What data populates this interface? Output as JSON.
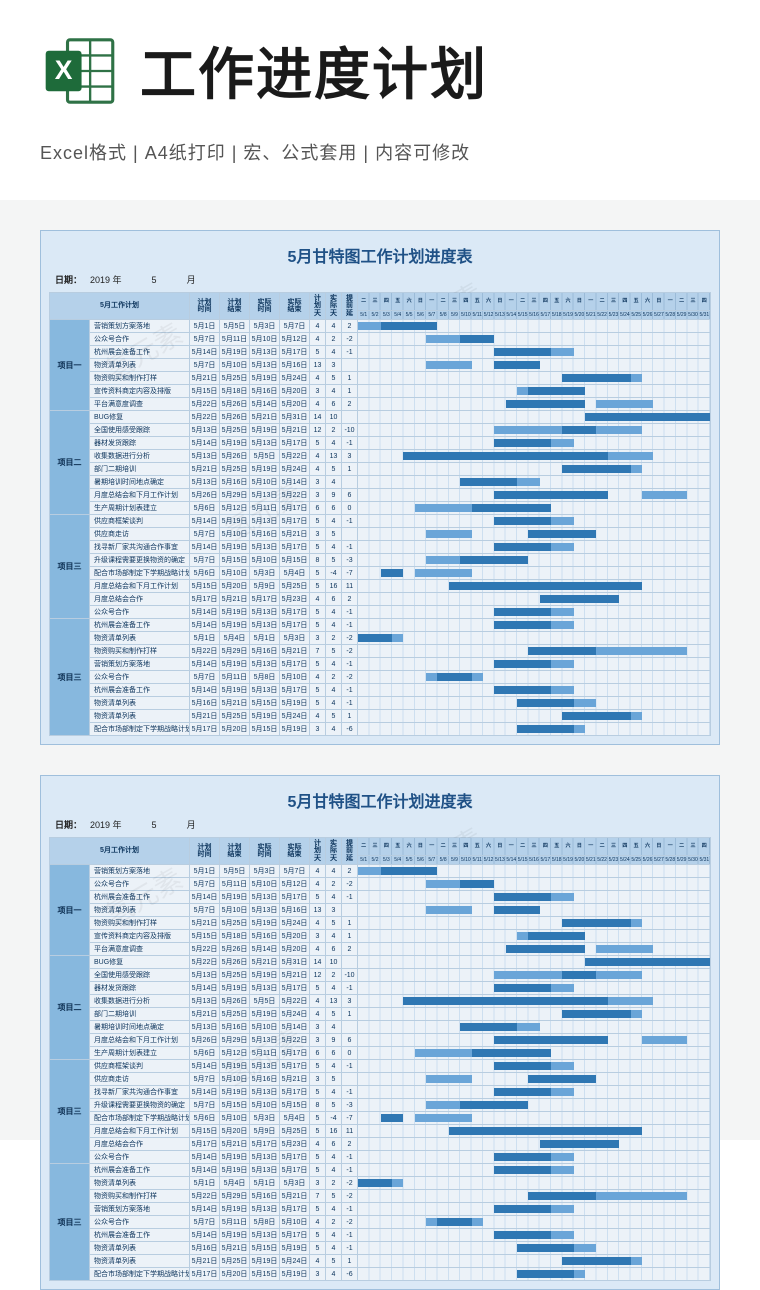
{
  "hero": {
    "title": "工作进度计划",
    "subtitle": "Excel格式 |  A4纸打印 | 宏、公式套用 | 内容可修改",
    "icon_name": "excel-icon"
  },
  "watermark_text": "氢元素",
  "sheet": {
    "title": "5月甘特图工作计划进度表",
    "date_label": "日期：",
    "year": "2019",
    "year_unit": "年",
    "month": "5",
    "month_unit": "月",
    "col_headers": {
      "plan_name": "5月工作计划",
      "plan_start": "计划\n时间",
      "plan_end": "计划\n结束",
      "act_start": "实际\n时间",
      "act_end": "实际\n结束",
      "plan_days": "计\n划\n天",
      "act_days": "实\n际\n天",
      "delay": "提\n前\n延"
    },
    "weekday_row": [
      "二",
      "三",
      "四",
      "五",
      "六",
      "日",
      "一",
      "二",
      "三",
      "四",
      "五",
      "六",
      "日",
      "一",
      "二",
      "三",
      "四",
      "五",
      "六",
      "日",
      "一",
      "二",
      "三",
      "四",
      "五",
      "六",
      "日",
      "一",
      "二",
      "三",
      "四"
    ],
    "date_row": [
      "5/1",
      "5/2",
      "5/3",
      "5/4",
      "5/5",
      "5/6",
      "5/7",
      "5/8",
      "5/9",
      "5/10",
      "5/11",
      "5/12",
      "5/13",
      "5/14",
      "5/15",
      "5/16",
      "5/17",
      "5/18",
      "5/19",
      "5/20",
      "5/21",
      "5/22",
      "5/23",
      "5/24",
      "5/25",
      "5/26",
      "5/27",
      "5/28",
      "5/29",
      "5/30",
      "5/31"
    ],
    "groups": [
      {
        "name": "项目一",
        "rows": [
          {
            "task": "营销策划方案落地",
            "ps": "5月1日",
            "pe": "5月5日",
            "as": "5月3日",
            "ae": "5月7日",
            "pd": 4,
            "ad": 4,
            "dl": 2,
            "b1": [
              1,
              5
            ],
            "b2": [
              3,
              7
            ]
          },
          {
            "task": "公众号合作",
            "ps": "5月7日",
            "pe": "5月11日",
            "as": "5月10日",
            "ae": "5月12日",
            "pd": 4,
            "ad": 2,
            "dl": -2,
            "b1": [
              7,
              11
            ],
            "b2": [
              10,
              12
            ]
          },
          {
            "task": "杭州展会准备工作",
            "ps": "5月14日",
            "pe": "5月19日",
            "as": "5月13日",
            "ae": "5月17日",
            "pd": 5,
            "ad": 4,
            "dl": -1,
            "b1": [
              14,
              19
            ],
            "b2": [
              13,
              17
            ]
          },
          {
            "task": "物资清单列表",
            "ps": "5月7日",
            "pe": "5月10日",
            "as": "5月13日",
            "ae": "5月16日",
            "pd": 13,
            "ad": 3,
            "dl": "",
            "b1": [
              7,
              10
            ],
            "b2": [
              13,
              16
            ]
          },
          {
            "task": "物资购买和制作打样",
            "ps": "5月21日",
            "pe": "5月25日",
            "as": "5月19日",
            "ae": "5月24日",
            "pd": 4,
            "ad": 5,
            "dl": 1,
            "b1": [
              21,
              25
            ],
            "b2": [
              19,
              24
            ]
          },
          {
            "task": "宣传资料商定内容及排版",
            "ps": "5月15日",
            "pe": "5月18日",
            "as": "5月16日",
            "ae": "5月20日",
            "pd": 3,
            "ad": 4,
            "dl": 1,
            "b1": [
              15,
              18
            ],
            "b2": [
              16,
              20
            ]
          },
          {
            "task": "平台满意度调查",
            "ps": "5月22日",
            "pe": "5月26日",
            "as": "5月14日",
            "ae": "5月20日",
            "pd": 4,
            "ad": 6,
            "dl": 2,
            "b1": [
              22,
              26
            ],
            "b2": [
              14,
              20
            ]
          }
        ]
      },
      {
        "name": "项目二",
        "rows": [
          {
            "task": "BUG修复",
            "ps": "5月22日",
            "pe": "5月26日",
            "as": "5月21日",
            "ae": "5月31日",
            "pd": 14,
            "ad": 10,
            "dl": "",
            "b1": [
              22,
              26
            ],
            "b2": [
              21,
              31
            ]
          },
          {
            "task": "全国使用感受跟踪",
            "ps": "5月13日",
            "pe": "5月25日",
            "as": "5月19日",
            "ae": "5月21日",
            "pd": 12,
            "ad": 2,
            "dl": -10,
            "b1": [
              13,
              25
            ],
            "b2": [
              19,
              21
            ]
          },
          {
            "task": "器材发货跟踪",
            "ps": "5月14日",
            "pe": "5月19日",
            "as": "5月13日",
            "ae": "5月17日",
            "pd": 5,
            "ad": 4,
            "dl": -1,
            "b1": [
              14,
              19
            ],
            "b2": [
              13,
              17
            ]
          },
          {
            "task": "收集数据进行分析",
            "ps": "5月13日",
            "pe": "5月26日",
            "as": "5月5日",
            "ae": "5月22日",
            "pd": 4,
            "ad": 13,
            "dl": 3,
            "b1": [
              13,
              26
            ],
            "b2": [
              5,
              22
            ]
          },
          {
            "task": "部门二期培训",
            "ps": "5月21日",
            "pe": "5月25日",
            "as": "5月19日",
            "ae": "5月24日",
            "pd": 4,
            "ad": 5,
            "dl": 1,
            "b1": [
              21,
              25
            ],
            "b2": [
              19,
              24
            ]
          },
          {
            "task": "暑期培训时间地点确定",
            "ps": "5月13日",
            "pe": "5月16日",
            "as": "5月10日",
            "ae": "5月14日",
            "pd": 3,
            "ad": 4,
            "dl": "",
            "b1": [
              13,
              16
            ],
            "b2": [
              10,
              14
            ]
          },
          {
            "task": "月度总结会和下月工作计划",
            "ps": "5月26日",
            "pe": "5月29日",
            "as": "5月13日",
            "ae": "5月22日",
            "pd": 3,
            "ad": 9,
            "dl": 6,
            "b1": [
              26,
              29
            ],
            "b2": [
              13,
              22
            ]
          },
          {
            "task": "生产周期计划表建立",
            "ps": "5月6日",
            "pe": "5月12日",
            "as": "5月11日",
            "ae": "5月17日",
            "pd": 6,
            "ad": 6,
            "dl": 0,
            "b1": [
              6,
              12
            ],
            "b2": [
              11,
              17
            ]
          }
        ]
      },
      {
        "name": "项目三",
        "rows": [
          {
            "task": "供应商框架谈判",
            "ps": "5月14日",
            "pe": "5月19日",
            "as": "5月13日",
            "ae": "5月17日",
            "pd": 5,
            "ad": 4,
            "dl": -1,
            "b1": [
              14,
              19
            ],
            "b2": [
              13,
              17
            ]
          },
          {
            "task": "供应商走访",
            "ps": "5月7日",
            "pe": "5月10日",
            "as": "5月16日",
            "ae": "5月21日",
            "pd": 3,
            "ad": 5,
            "dl": "",
            "b1": [
              7,
              10
            ],
            "b2": [
              16,
              21
            ]
          },
          {
            "task": "找寻新厂家共沟通合作事宜",
            "ps": "5月14日",
            "pe": "5月19日",
            "as": "5月13日",
            "ae": "5月17日",
            "pd": 5,
            "ad": 4,
            "dl": -1,
            "b1": [
              14,
              19
            ],
            "b2": [
              13,
              17
            ]
          },
          {
            "task": "升级课程需要更换物资的确定",
            "ps": "5月7日",
            "pe": "5月15日",
            "as": "5月10日",
            "ae": "5月15日",
            "pd": 8,
            "ad": 5,
            "dl": -3,
            "b1": [
              7,
              15
            ],
            "b2": [
              10,
              15
            ]
          },
          {
            "task": "配合市场部制定下学期战略计划",
            "ps": "5月6日",
            "pe": "5月10日",
            "as": "5月3日",
            "ae": "5月4日",
            "pd": 5,
            "ad": -4,
            "dl": -7,
            "b1": [
              6,
              10
            ],
            "b2": [
              3,
              4
            ]
          },
          {
            "task": "月度总结会和下月工作计划",
            "ps": "5月15日",
            "pe": "5月20日",
            "as": "5月9日",
            "ae": "5月25日",
            "pd": 5,
            "ad": 16,
            "dl": 11,
            "b1": [
              15,
              20
            ],
            "b2": [
              9,
              25
            ]
          },
          {
            "task": "月度总结会合作",
            "ps": "5月17日",
            "pe": "5月21日",
            "as": "5月17日",
            "ae": "5月23日",
            "pd": 4,
            "ad": 6,
            "dl": 2,
            "b1": [
              17,
              21
            ],
            "b2": [
              17,
              23
            ]
          },
          {
            "task": "公众号合作",
            "ps": "5月14日",
            "pe": "5月19日",
            "as": "5月13日",
            "ae": "5月17日",
            "pd": 5,
            "ad": 4,
            "dl": -1,
            "b1": [
              14,
              19
            ],
            "b2": [
              13,
              17
            ]
          }
        ]
      },
      {
        "name": "项目三",
        "rows": [
          {
            "task": "杭州展会准备工作",
            "ps": "5月14日",
            "pe": "5月19日",
            "as": "5月13日",
            "ae": "5月17日",
            "pd": 5,
            "ad": 4,
            "dl": -1,
            "b1": [
              14,
              19
            ],
            "b2": [
              13,
              17
            ]
          },
          {
            "task": "物资清单列表",
            "ps": "5月1日",
            "pe": "5月4日",
            "as": "5月1日",
            "ae": "5月3日",
            "pd": 3,
            "ad": 2,
            "dl": -2,
            "b1": [
              1,
              4
            ],
            "b2": [
              1,
              3
            ]
          },
          {
            "task": "物资购买和制作打样",
            "ps": "5月22日",
            "pe": "5月29日",
            "as": "5月16日",
            "ae": "5月21日",
            "pd": 7,
            "ad": 5,
            "dl": -2,
            "b1": [
              22,
              29
            ],
            "b2": [
              16,
              21
            ]
          },
          {
            "task": "营销策划方案落地",
            "ps": "5月14日",
            "pe": "5月19日",
            "as": "5月13日",
            "ae": "5月17日",
            "pd": 5,
            "ad": 4,
            "dl": -1,
            "b1": [
              14,
              19
            ],
            "b2": [
              13,
              17
            ]
          },
          {
            "task": "公众号合作",
            "ps": "5月7日",
            "pe": "5月11日",
            "as": "5月8日",
            "ae": "5月10日",
            "pd": 4,
            "ad": 2,
            "dl": -2,
            "b1": [
              7,
              11
            ],
            "b2": [
              8,
              10
            ]
          },
          {
            "task": "杭州展会准备工作",
            "ps": "5月14日",
            "pe": "5月19日",
            "as": "5月13日",
            "ae": "5月17日",
            "pd": 5,
            "ad": 4,
            "dl": -1,
            "b1": [
              14,
              19
            ],
            "b2": [
              13,
              17
            ]
          },
          {
            "task": "物资清单列表",
            "ps": "5月16日",
            "pe": "5月21日",
            "as": "5月15日",
            "ae": "5月19日",
            "pd": 5,
            "ad": 4,
            "dl": -1,
            "b1": [
              16,
              21
            ],
            "b2": [
              15,
              19
            ]
          },
          {
            "task": "物资清单列表",
            "ps": "5月21日",
            "pe": "5月25日",
            "as": "5月19日",
            "ae": "5月24日",
            "pd": 4,
            "ad": 5,
            "dl": 1,
            "b1": [
              21,
              25
            ],
            "b2": [
              19,
              24
            ]
          },
          {
            "task": "配合市场部制定下学期战略计划",
            "ps": "5月17日",
            "pe": "5月20日",
            "as": "5月15日",
            "ae": "5月19日",
            "pd": 3,
            "ad": 4,
            "dl": -6,
            "b1": [
              17,
              20
            ],
            "b2": [
              15,
              19
            ]
          }
        ]
      }
    ]
  }
}
